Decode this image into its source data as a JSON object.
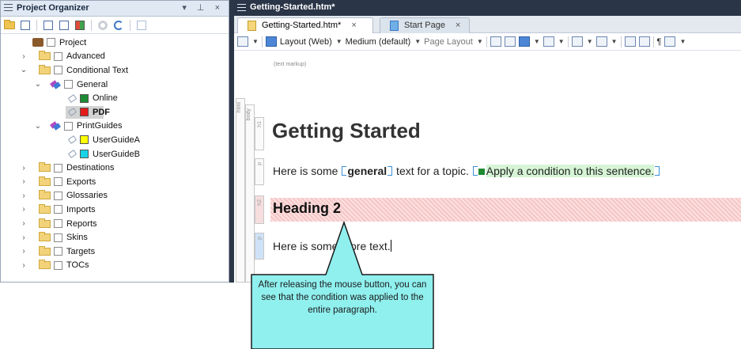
{
  "project_organizer": {
    "title": "Project Organizer",
    "controls": "▾ ⊥ ×",
    "tree": [
      {
        "label": "Project",
        "level": 0,
        "icon": "briefcase-icon",
        "expander": ""
      },
      {
        "label": "Advanced",
        "level": 1,
        "icon": "folder-icon",
        "expander": "›"
      },
      {
        "label": "Conditional Text",
        "level": 1,
        "icon": "folder-icon",
        "expander": "⌄"
      },
      {
        "label": "General",
        "level": 2,
        "icon": "condition-set-icon",
        "expander": "⌄"
      },
      {
        "label": "Online",
        "level": 3,
        "icon": "tag-icon",
        "swatch": "#1e8a32"
      },
      {
        "label": "PDF",
        "level": 3,
        "icon": "tag-icon",
        "swatch": "#e41b1b",
        "selected": true
      },
      {
        "label": "PrintGuides",
        "level": 2,
        "icon": "condition-set-icon",
        "expander": "⌄"
      },
      {
        "label": "UserGuideA",
        "level": 3,
        "icon": "tag-icon",
        "swatch": "#ffff00"
      },
      {
        "label": "UserGuideB",
        "level": 3,
        "icon": "tag-icon",
        "swatch": "#19d3e6"
      },
      {
        "label": "Destinations",
        "level": 1,
        "icon": "folder-icon",
        "expander": "›"
      },
      {
        "label": "Exports",
        "level": 1,
        "icon": "folder-icon",
        "expander": "›"
      },
      {
        "label": "Glossaries",
        "level": 1,
        "icon": "folder-icon",
        "expander": "›"
      },
      {
        "label": "Imports",
        "level": 1,
        "icon": "folder-icon",
        "expander": "›"
      },
      {
        "label": "Reports",
        "level": 1,
        "icon": "folder-icon",
        "expander": "›"
      },
      {
        "label": "Skins",
        "level": 1,
        "icon": "folder-icon",
        "expander": "›"
      },
      {
        "label": "Targets",
        "level": 1,
        "icon": "folder-icon",
        "expander": "›"
      },
      {
        "label": "TOCs",
        "level": 1,
        "icon": "folder-icon",
        "expander": "›"
      }
    ]
  },
  "editor": {
    "title": "Getting-Started.htm*",
    "tabs": [
      {
        "label": "Getting-Started.htm*",
        "close": "×",
        "active": true
      },
      {
        "label": "Start Page",
        "close": "×",
        "active": false
      }
    ],
    "toolbar": {
      "layout": "Layout (Web)",
      "medium": "Medium (default)",
      "page_layout": "Page Layout",
      "pilcrow": "¶"
    },
    "markup_hint": "(text markup)",
    "structure": {
      "html": "html",
      "body": "body",
      "h1": "h1",
      "p": "p",
      "h2": "h2",
      "p2": "p"
    },
    "content": {
      "heading1": "Getting Started",
      "para1_before": "Here is some ",
      "para1_bold": "general",
      "para1_after": " text for a topic. ",
      "para1_condition": "Apply a condition to this sentence.",
      "heading2": "Heading 2",
      "para2": "Here is some more text."
    }
  },
  "callout": {
    "text": "After releasing the mouse button, you can see that the condition was applied to the entire paragraph.",
    "fill": "#8ff0ee"
  }
}
